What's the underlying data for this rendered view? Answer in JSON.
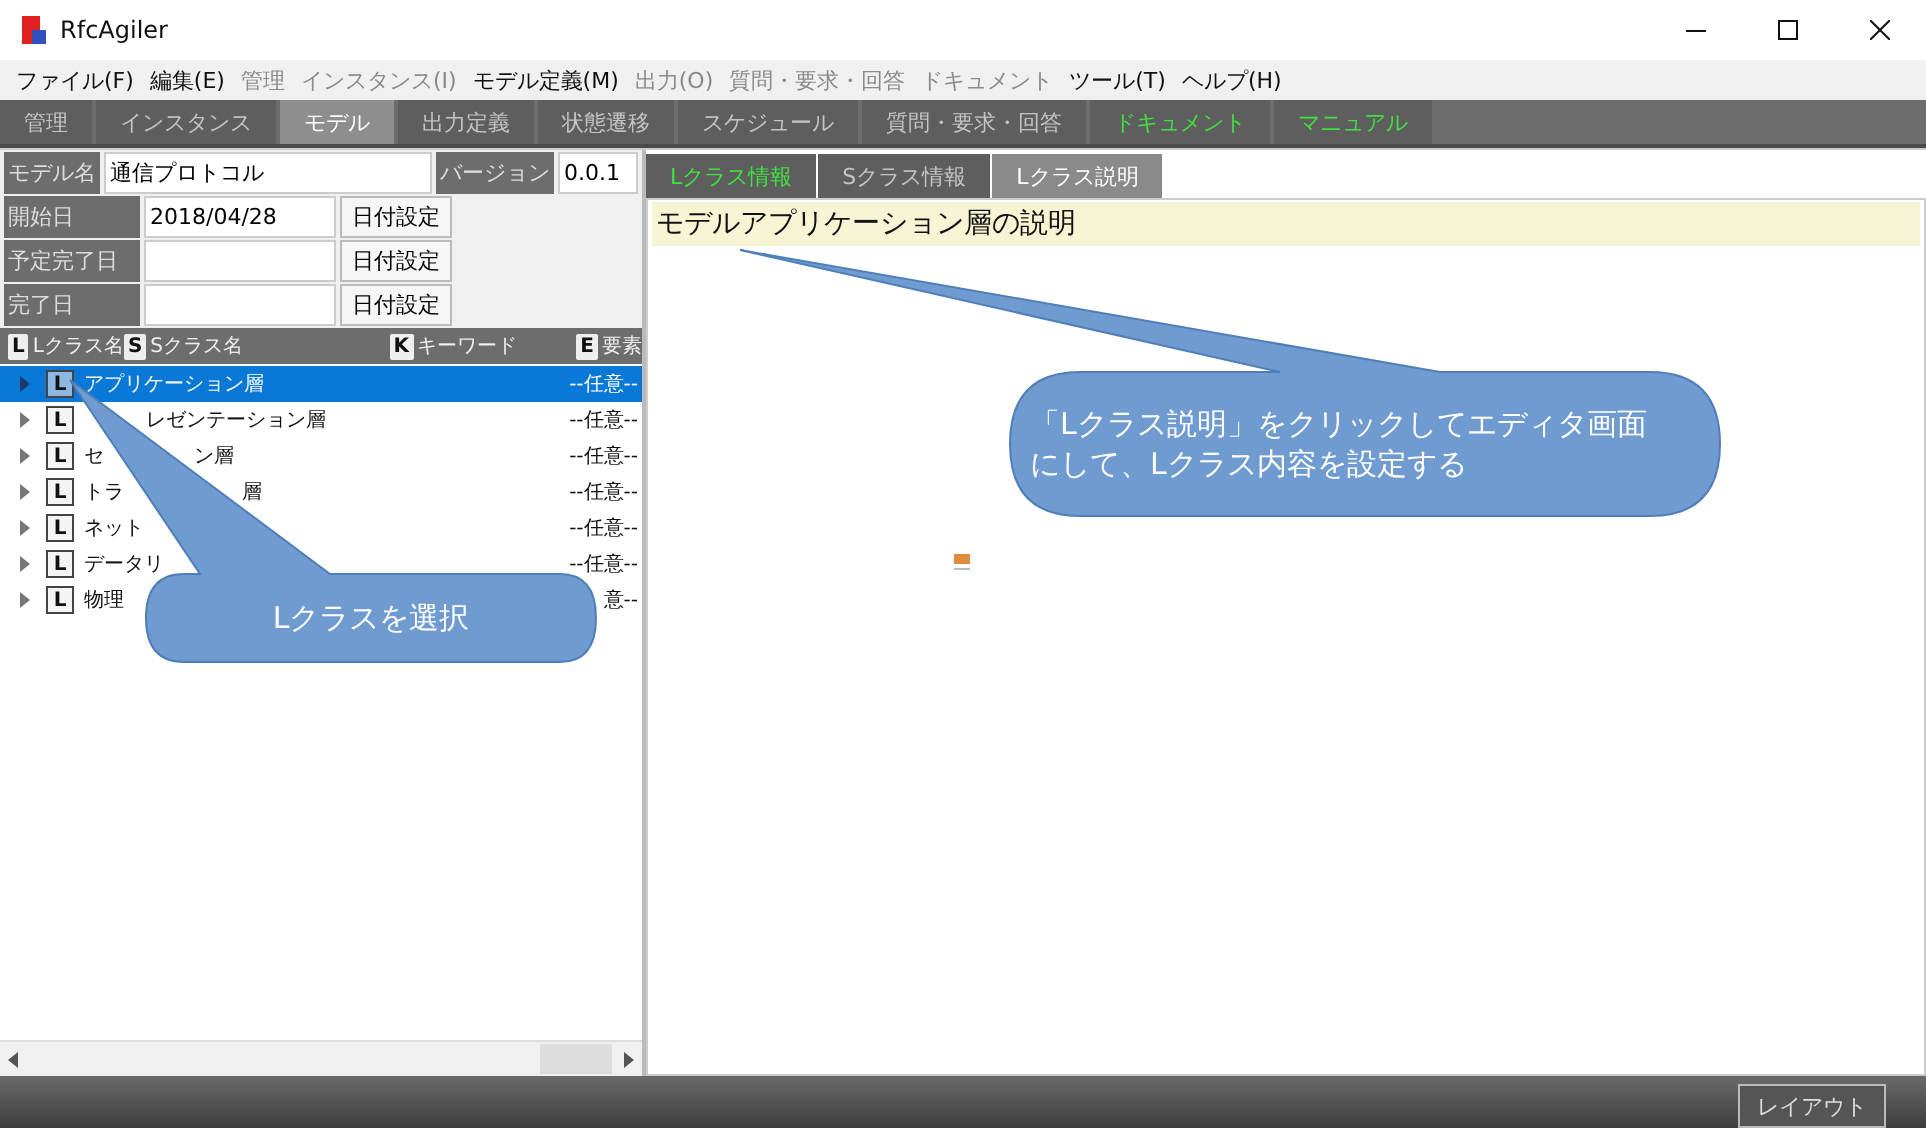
{
  "window": {
    "title": "RfcAgiler"
  },
  "menu": [
    {
      "label": "ファイル(F)",
      "disabled": false
    },
    {
      "label": "編集(E)",
      "disabled": false
    },
    {
      "label": "管理",
      "disabled": true
    },
    {
      "label": "インスタンス(I)",
      "disabled": true
    },
    {
      "label": "モデル定義(M)",
      "disabled": false
    },
    {
      "label": "出力(O)",
      "disabled": true
    },
    {
      "label": "質問・要求・回答",
      "disabled": true
    },
    {
      "label": "ドキュメント",
      "disabled": true
    },
    {
      "label": "ツール(T)",
      "disabled": false
    },
    {
      "label": "ヘルプ(H)",
      "disabled": false
    }
  ],
  "tabs": [
    {
      "label": "管理",
      "selected": false,
      "kind": "disabled"
    },
    {
      "label": "インスタンス",
      "selected": false,
      "kind": "disabled"
    },
    {
      "label": "モデル",
      "selected": true,
      "kind": "enabled"
    },
    {
      "label": "出力定義",
      "selected": false,
      "kind": "disabled"
    },
    {
      "label": "状態遷移",
      "selected": false,
      "kind": "disabled"
    },
    {
      "label": "スケジュール",
      "selected": false,
      "kind": "disabled"
    },
    {
      "label": "質問・要求・回答",
      "selected": false,
      "kind": "disabled"
    },
    {
      "label": "ドキュメント",
      "selected": false,
      "kind": "highlighted"
    },
    {
      "label": "マニュアル",
      "selected": false,
      "kind": "highlighted"
    }
  ],
  "model": {
    "name_label": "モデル名",
    "name": "通信プロトコル",
    "version_label": "バージョン",
    "version": "0.0.1"
  },
  "dates": [
    {
      "label": "開始日",
      "value": "2018/04/28",
      "button": "日付設定"
    },
    {
      "label": "予定完了日",
      "button": "日付設定"
    },
    {
      "label": "完了日",
      "button": "日付設定"
    }
  ],
  "columns": [
    {
      "badge": "L",
      "label": "Lクラス名"
    },
    {
      "badge": "S",
      "label": "Sクラス名"
    },
    {
      "badge": "K",
      "label": "キーワード"
    },
    {
      "badge": "E",
      "label": "要素"
    }
  ],
  "rows": [
    {
      "badge": "L",
      "name": "アプリケーション層",
      "value": "--任意--",
      "selected": true
    },
    {
      "badge": "L",
      "name_after": "レゼンテーション層",
      "value": "--任意--",
      "selected": false
    },
    {
      "badge": "L",
      "name": "セ",
      "name_after": "ン層",
      "value": "--任意--",
      "selected": false
    },
    {
      "badge": "L",
      "name": "トラ",
      "name_after": "層",
      "value": "--任意--",
      "selected": false
    },
    {
      "badge": "L",
      "name": "ネット",
      "value": "--任意--",
      "selected": false
    },
    {
      "badge": "L",
      "name": "データリ",
      "value": "--任意--",
      "selected": false
    },
    {
      "badge": "L",
      "name": "物理",
      "value": "意--",
      "selected": false
    }
  ],
  "subtabs": [
    {
      "label": "Lクラス情報",
      "selected": false,
      "kind": "highlighted"
    },
    {
      "label": "Sクラス情報",
      "selected": false,
      "kind": "disabled"
    },
    {
      "label": "Lクラス説明",
      "selected": true,
      "kind": "enabled"
    }
  ],
  "editor": {
    "heading": "モデルアプリケーション層の説明"
  },
  "callouts": [
    {
      "text": "「Lクラス説明」をクリックしてエディタ画面にして、Lクラス内容を設定する"
    },
    {
      "text": "Lクラスを選択"
    }
  ],
  "status_bar": {
    "button": "レイアウト"
  }
}
